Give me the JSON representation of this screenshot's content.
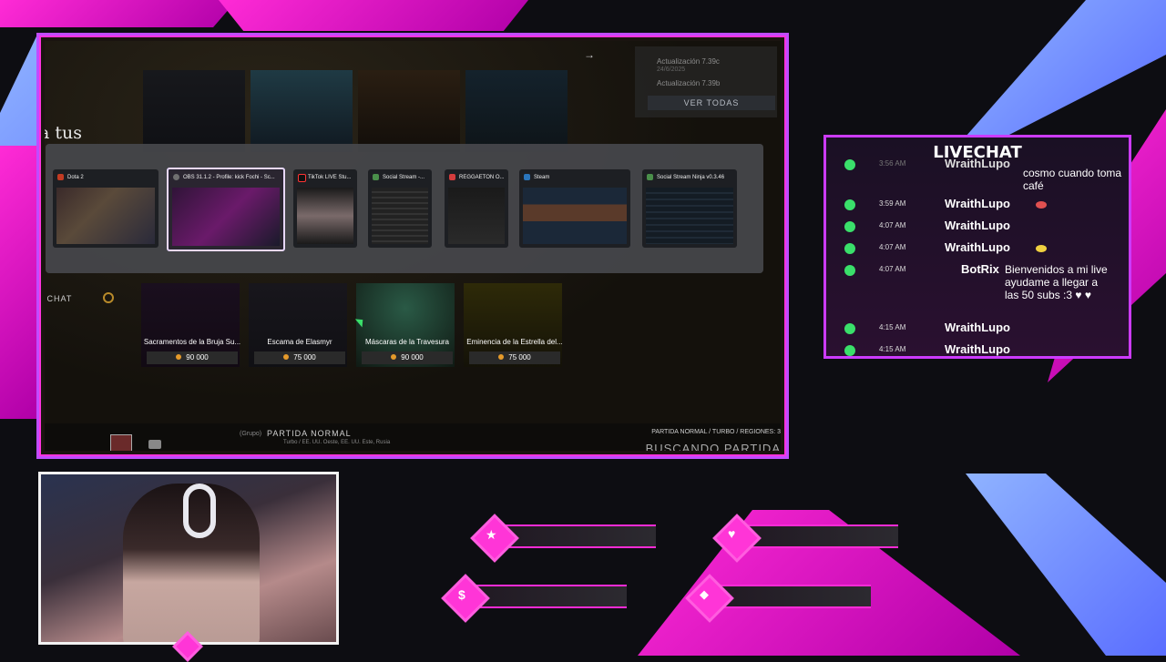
{
  "chat": {
    "title": "LIVECHAT",
    "messages": [
      {
        "time": "3:56 AM",
        "user": "WraithLupo",
        "text": "cosmo cuando toma café"
      },
      {
        "time": "3:59 AM",
        "user": "WraithLupo",
        "text": ""
      },
      {
        "time": "4:07 AM",
        "user": "WraithLupo",
        "text": ""
      },
      {
        "time": "4:07 AM",
        "user": "WraithLupo",
        "text": ""
      },
      {
        "time": "4:07 AM",
        "user": "BotRix",
        "text": "Bienvenidos a mi live ayudame a llegar a las 50 subs :3 ♥ ♥"
      },
      {
        "time": "4:15 AM",
        "user": "WraithLupo",
        "text": ""
      },
      {
        "time": "4:15 AM",
        "user": "WraithLupo",
        "text": ""
      }
    ]
  },
  "game": {
    "updates": [
      {
        "title": "Actualización 7.39c",
        "date": "24/6/2025"
      },
      {
        "title": "Actualización 7.39b"
      }
    ],
    "see_all": "VER TODAS",
    "side_text": "a tus",
    "side_chat": "E CHAT",
    "items": [
      {
        "name": "Sacramentos de la Bruja Su...",
        "price": "90 000"
      },
      {
        "name": "Escama de Elasmyr",
        "price": "75 000"
      },
      {
        "name": "Máscaras de la Travesura",
        "price": "90 000"
      },
      {
        "name": "Eminencia de la Estrella del...",
        "price": "75 000"
      }
    ],
    "group_label": "(Grupo)",
    "match_type": "PARTIDA NORMAL",
    "match_details": "Turbo / EE. UU. Oeste, EE. UU. Este, Rusia",
    "mode_summary": "PARTIDA NORMAL / TURBO / REGIONES: 3",
    "search_status": "BUSCANDO PARTIDA"
  },
  "alt_tab": {
    "windows": [
      {
        "title": "Dota 2",
        "color": "#c23b22"
      },
      {
        "title": "OBS 31.1.2 - Profile: kick Fochi - Sc...",
        "color": "#6f6f6f"
      },
      {
        "title": "TikTok LIVE Stu...",
        "color": "#111111"
      },
      {
        "title": "Social Stream -...",
        "color": "#4a8f4a"
      },
      {
        "title": "REGGAETON O...",
        "color": "#d43c3c"
      },
      {
        "title": "Steam",
        "color": "#2a75bb"
      },
      {
        "title": "Social Stream Ninja v0.3.46",
        "color": "#4a8f4a"
      }
    ]
  },
  "colors": {
    "accent_pink": "#ff2bd6",
    "accent_purple": "#c04cff",
    "accent_blue": "#6f86ff"
  }
}
